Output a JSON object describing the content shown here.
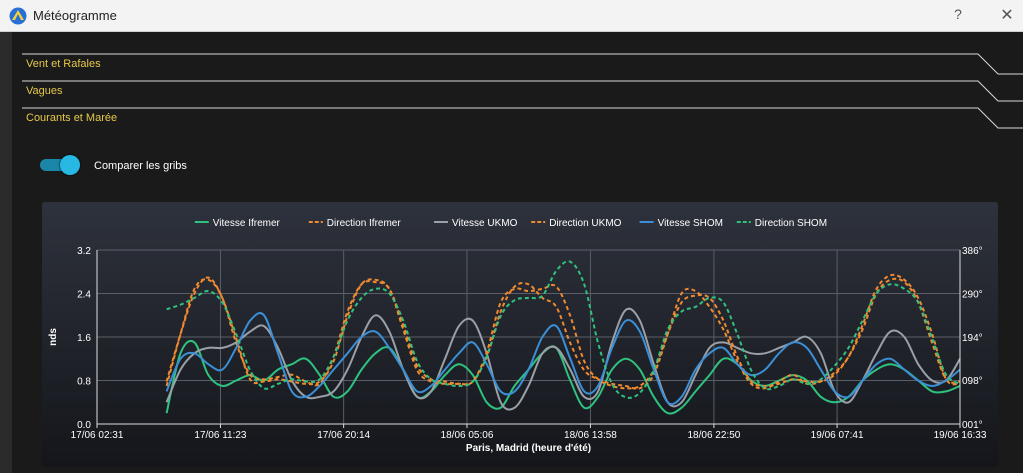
{
  "window": {
    "title": "Météogramme",
    "help": "?",
    "close": "✕",
    "icon": "app-logo-icon"
  },
  "sections": [
    {
      "label": "Vent et Rafales"
    },
    {
      "label": "Vagues"
    },
    {
      "label": "Courants et Marée"
    }
  ],
  "toggle": {
    "label": "Comparer les gribs",
    "on": true
  },
  "colors": {
    "accent": "#e6c84a",
    "toggle": "#27b8e4",
    "ifremer": "#2ec27e",
    "ukmo": "#9aa0a8",
    "shom": "#3b8fd6",
    "dir_orange": "#f08a30",
    "dir_green": "#2ec27e"
  },
  "chart_data": {
    "type": "line",
    "xlabel": "Paris, Madrid (heure d'été)",
    "ylabel": "nds",
    "xlim": [
      0,
      62
    ],
    "ylim": [
      0,
      3.2
    ],
    "y2lim": [
      1,
      386
    ],
    "x_ticks": [
      {
        "x": 0,
        "label": "17/06 02:31"
      },
      {
        "x": 8.87,
        "label": "17/06 11:23"
      },
      {
        "x": 17.72,
        "label": "17/06 20:14"
      },
      {
        "x": 26.58,
        "label": "18/06 05:06"
      },
      {
        "x": 35.45,
        "label": "18/06 13:58"
      },
      {
        "x": 44.32,
        "label": "18/06 22:50"
      },
      {
        "x": 53.17,
        "label": "19/06 07:41"
      },
      {
        "x": 62,
        "label": "19/06 16:33"
      }
    ],
    "y_ticks": [
      "0.0",
      "0.8",
      "1.6",
      "2.4",
      "3.2"
    ],
    "y2_ticks": [
      {
        "v": 1,
        "label": "001°"
      },
      {
        "v": 98,
        "label": "098°"
      },
      {
        "v": 194,
        "label": "194°"
      },
      {
        "v": 290,
        "label": "290°"
      },
      {
        "v": 386,
        "label": "386°"
      }
    ],
    "legend_position": "top",
    "grid": true,
    "x": [
      5,
      6,
      7,
      8,
      9,
      10,
      11,
      12,
      13,
      14,
      15,
      16,
      17,
      18,
      19,
      20,
      21,
      22,
      23,
      24,
      25,
      26,
      27,
      28,
      29,
      30,
      31,
      32,
      33,
      34,
      35,
      36,
      37,
      38,
      39,
      40,
      41,
      42,
      43,
      44,
      45,
      46,
      47,
      48,
      49,
      50,
      51,
      52,
      53,
      54,
      55,
      56,
      57,
      58,
      59,
      60,
      61,
      62
    ],
    "series": [
      {
        "name": "Vitesse Ifremer",
        "axis": "left",
        "style": "solid",
        "color": "#2ec27e",
        "values": [
          0.2,
          1.3,
          1.5,
          0.9,
          0.7,
          0.8,
          0.9,
          0.8,
          1.0,
          1.1,
          1.2,
          0.9,
          0.5,
          0.6,
          1.0,
          1.3,
          1.4,
          1.0,
          0.5,
          0.6,
          0.9,
          1.1,
          0.9,
          0.4,
          0.3,
          0.7,
          1.0,
          1.3,
          1.4,
          0.8,
          0.3,
          0.5,
          1.0,
          1.2,
          1.0,
          0.5,
          0.2,
          0.3,
          0.6,
          0.9,
          1.2,
          1.1,
          0.8,
          0.7,
          0.8,
          0.9,
          0.8,
          0.5,
          0.4,
          0.5,
          0.8,
          1.0,
          1.1,
          1.0,
          0.8,
          0.6,
          0.6,
          0.7
        ]
      },
      {
        "name": "Direction Ifremer",
        "axis": "right",
        "style": "dash",
        "color": "#f08a30",
        "values": [
          85,
          200,
          300,
          320,
          280,
          180,
          110,
          100,
          105,
          110,
          95,
          90,
          150,
          250,
          310,
          315,
          300,
          220,
          130,
          100,
          95,
          90,
          95,
          150,
          250,
          305,
          310,
          280,
          260,
          180,
          120,
          100,
          90,
          85,
          80,
          110,
          200,
          290,
          295,
          260,
          210,
          140,
          90,
          80,
          95,
          110,
          90,
          95,
          115,
          150,
          220,
          300,
          330,
          320,
          280,
          200,
          100,
          90
        ]
      },
      {
        "name": "Vitesse UKMO",
        "axis": "left",
        "style": "solid",
        "color": "#9aa0a8",
        "values": [
          0.4,
          1.0,
          1.3,
          1.4,
          1.4,
          1.5,
          1.7,
          1.8,
          1.4,
          0.8,
          0.5,
          0.5,
          0.6,
          1.0,
          1.6,
          2.0,
          1.7,
          1.0,
          0.5,
          0.6,
          1.2,
          1.8,
          1.9,
          1.3,
          0.4,
          0.3,
          0.7,
          1.3,
          1.4,
          1.0,
          0.5,
          0.6,
          1.5,
          2.1,
          1.9,
          1.1,
          0.4,
          0.4,
          0.9,
          1.4,
          1.5,
          1.4,
          1.3,
          1.3,
          1.4,
          1.5,
          1.6,
          1.3,
          0.6,
          0.4,
          0.8,
          1.3,
          1.7,
          1.6,
          1.1,
          0.8,
          0.8,
          1.2
        ]
      },
      {
        "name": "Direction UKMO",
        "axis": "right",
        "style": "dash",
        "color": "#f08a30",
        "values": [
          95,
          200,
          290,
          325,
          280,
          190,
          100,
          95,
          100,
          95,
          90,
          95,
          140,
          240,
          310,
          320,
          300,
          210,
          120,
          95,
          90,
          90,
          95,
          160,
          270,
          300,
          295,
          300,
          305,
          240,
          140,
          100,
          85,
          80,
          85,
          120,
          200,
          270,
          285,
          280,
          230,
          150,
          95,
          85,
          90,
          100,
          95,
          95,
          110,
          150,
          210,
          290,
          320,
          315,
          270,
          180,
          100,
          95
        ]
      },
      {
        "name": "Vitesse SHOM",
        "axis": "left",
        "style": "solid",
        "color": "#3b8fd6",
        "values": [
          0.6,
          1.2,
          1.3,
          1.1,
          1.0,
          1.4,
          1.9,
          2.0,
          1.3,
          0.6,
          0.5,
          0.7,
          1.0,
          1.3,
          1.6,
          1.7,
          1.4,
          1.0,
          0.6,
          0.7,
          1.0,
          1.3,
          1.5,
          1.1,
          0.6,
          0.6,
          1.0,
          1.6,
          1.8,
          1.2,
          0.6,
          0.7,
          1.4,
          1.9,
          1.7,
          1.0,
          0.4,
          0.5,
          1.0,
          1.3,
          1.4,
          1.1,
          0.9,
          1.0,
          1.3,
          1.5,
          1.4,
          1.0,
          0.6,
          0.5,
          0.8,
          1.1,
          1.2,
          1.0,
          0.8,
          0.7,
          0.8,
          1.0
        ]
      },
      {
        "name": "Direction SHOM",
        "axis": "right",
        "style": "dash",
        "color": "#2ec27e",
        "values": [
          255,
          265,
          280,
          295,
          270,
          200,
          120,
          80,
          90,
          100,
          95,
          100,
          150,
          230,
          280,
          300,
          290,
          230,
          140,
          100,
          90,
          85,
          95,
          150,
          240,
          275,
          280,
          285,
          340,
          360,
          310,
          180,
          90,
          60,
          70,
          120,
          210,
          250,
          260,
          280,
          270,
          200,
          120,
          80,
          85,
          100,
          90,
          100,
          130,
          170,
          230,
          290,
          310,
          300,
          270,
          190,
          110,
          90
        ]
      }
    ]
  }
}
